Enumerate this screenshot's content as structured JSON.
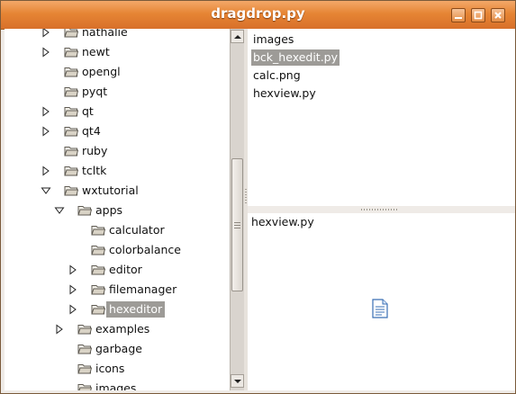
{
  "window": {
    "title": "dragdrop.py"
  },
  "tree": {
    "items": [
      {
        "label": "nathalie",
        "level": 1,
        "expander": "collapsed",
        "selected": false,
        "clipped": true
      },
      {
        "label": "newt",
        "level": 1,
        "expander": "collapsed",
        "selected": false
      },
      {
        "label": "opengl",
        "level": 1,
        "expander": "none",
        "selected": false
      },
      {
        "label": "pyqt",
        "level": 1,
        "expander": "none",
        "selected": false
      },
      {
        "label": "qt",
        "level": 1,
        "expander": "collapsed",
        "selected": false
      },
      {
        "label": "qt4",
        "level": 1,
        "expander": "collapsed",
        "selected": false
      },
      {
        "label": "ruby",
        "level": 1,
        "expander": "none",
        "selected": false
      },
      {
        "label": "tcltk",
        "level": 1,
        "expander": "collapsed",
        "selected": false
      },
      {
        "label": "wxtutorial",
        "level": 1,
        "expander": "expanded",
        "selected": false
      },
      {
        "label": "apps",
        "level": 2,
        "expander": "expanded",
        "selected": false
      },
      {
        "label": "calculator",
        "level": 3,
        "expander": "none",
        "selected": false
      },
      {
        "label": "colorbalance",
        "level": 3,
        "expander": "none",
        "selected": false
      },
      {
        "label": "editor",
        "level": 3,
        "expander": "collapsed",
        "selected": false
      },
      {
        "label": "filemanager",
        "level": 3,
        "expander": "collapsed",
        "selected": false
      },
      {
        "label": "hexeditor",
        "level": 3,
        "expander": "collapsed",
        "selected": true
      },
      {
        "label": "examples",
        "level": 2,
        "expander": "collapsed",
        "selected": false
      },
      {
        "label": "garbage",
        "level": 2,
        "expander": "none",
        "selected": false
      },
      {
        "label": "icons",
        "level": 2,
        "expander": "none",
        "selected": false
      },
      {
        "label": "images",
        "level": 2,
        "expander": "none",
        "selected": false,
        "clipped": true
      }
    ]
  },
  "files": {
    "items": [
      {
        "label": "images",
        "selected": false
      },
      {
        "label": "bck_hexedit.py",
        "selected": true
      },
      {
        "label": "calc.png",
        "selected": false
      },
      {
        "label": "hexview.py",
        "selected": false
      }
    ]
  },
  "drop": {
    "text": "hexview.py",
    "icon": "text-document-icon"
  },
  "colors": {
    "titlebar": "#e68534",
    "selection": "#9d9b97",
    "folder": "#6e6a62",
    "window_bg": "#efebe7"
  }
}
